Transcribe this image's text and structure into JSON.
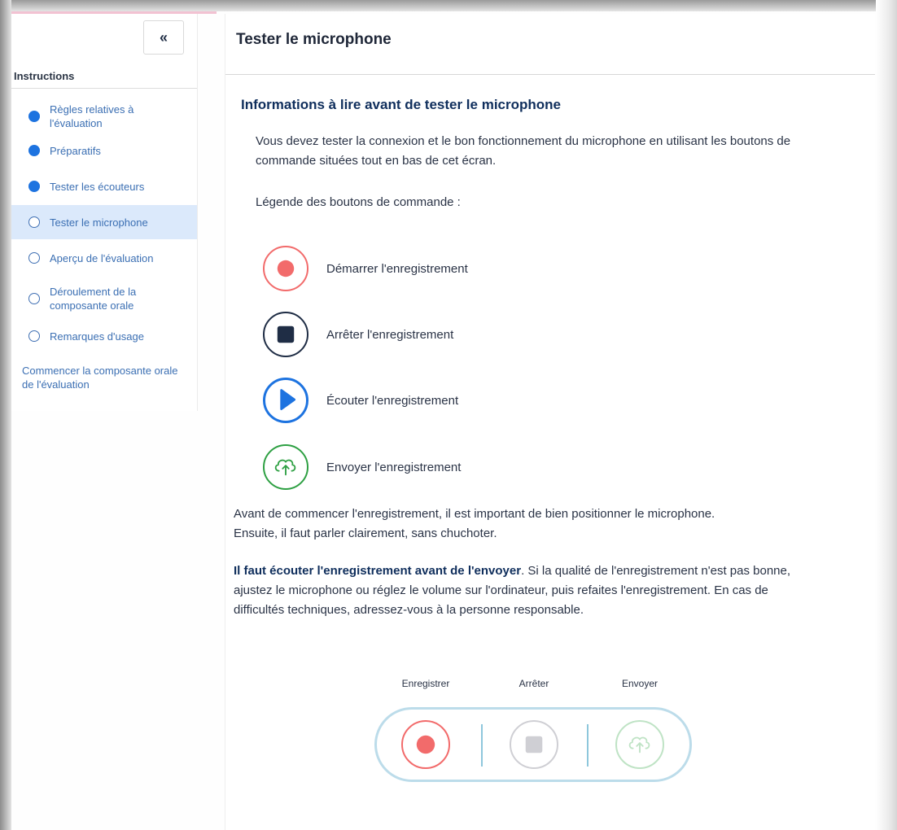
{
  "sidebar": {
    "collapse_label": "«",
    "section_label": "Instructions",
    "items": [
      {
        "label": "Règles relatives à\nl'évaluation",
        "state": "done"
      },
      {
        "label": "Préparatifs",
        "state": "done"
      },
      {
        "label": "Tester les écouteurs",
        "state": "done"
      },
      {
        "label": "Tester le microphone",
        "state": "current"
      },
      {
        "label": "Aperçu de l'évaluation",
        "state": "todo"
      },
      {
        "label": "Déroulement de la\ncomposante orale",
        "state": "todo"
      },
      {
        "label": "Remarques d'usage",
        "state": "todo"
      }
    ],
    "start_link": "Commencer la composante orale de l'évaluation"
  },
  "main": {
    "title": "Tester le microphone",
    "section_title": "Informations à lire avant de tester le microphone",
    "intro": "Vous devez tester la connexion et le bon fonctionnement du microphone en utilisant les boutons de commande situées tout en bas de cet écran.",
    "legend_heading": "Légende des boutons de commande :",
    "legend": [
      {
        "icon": "record-icon",
        "label": "Démarrer l'enregistrement",
        "color": "#f26b6b"
      },
      {
        "icon": "stop-icon",
        "label": "Arrêter l'enregistrement",
        "color": "#1f2d45"
      },
      {
        "icon": "play-icon",
        "label": "Écouter l'enregistrement",
        "color": "#1d73e0"
      },
      {
        "icon": "cloud-upload-icon",
        "label": "Envoyer l'enregistrement",
        "color": "#2ea043"
      }
    ],
    "positioning_text": "Avant de commencer l'enregistrement, il est important de bien positionner le microphone. Ensuite, il faut parler clairement, sans chuchoter.",
    "listen_bold": "Il faut écouter l'enregistrement avant de l'envoyer",
    "listen_rest": ". Si la qualité de l'enregistrement n'est pas bonne, ajustez le microphone ou réglez le volume sur l'ordinateur, puis refaites l'enregistrement. En cas de difficultés techniques, adressez-vous à la personne responsable."
  },
  "controls": {
    "record_label": "Enregistrer",
    "stop_label": "Arrêter",
    "send_label": "Envoyer",
    "record_color": "#f26b6b",
    "stop_color": "#cfcfd4",
    "send_color": "#bfe3c5"
  }
}
